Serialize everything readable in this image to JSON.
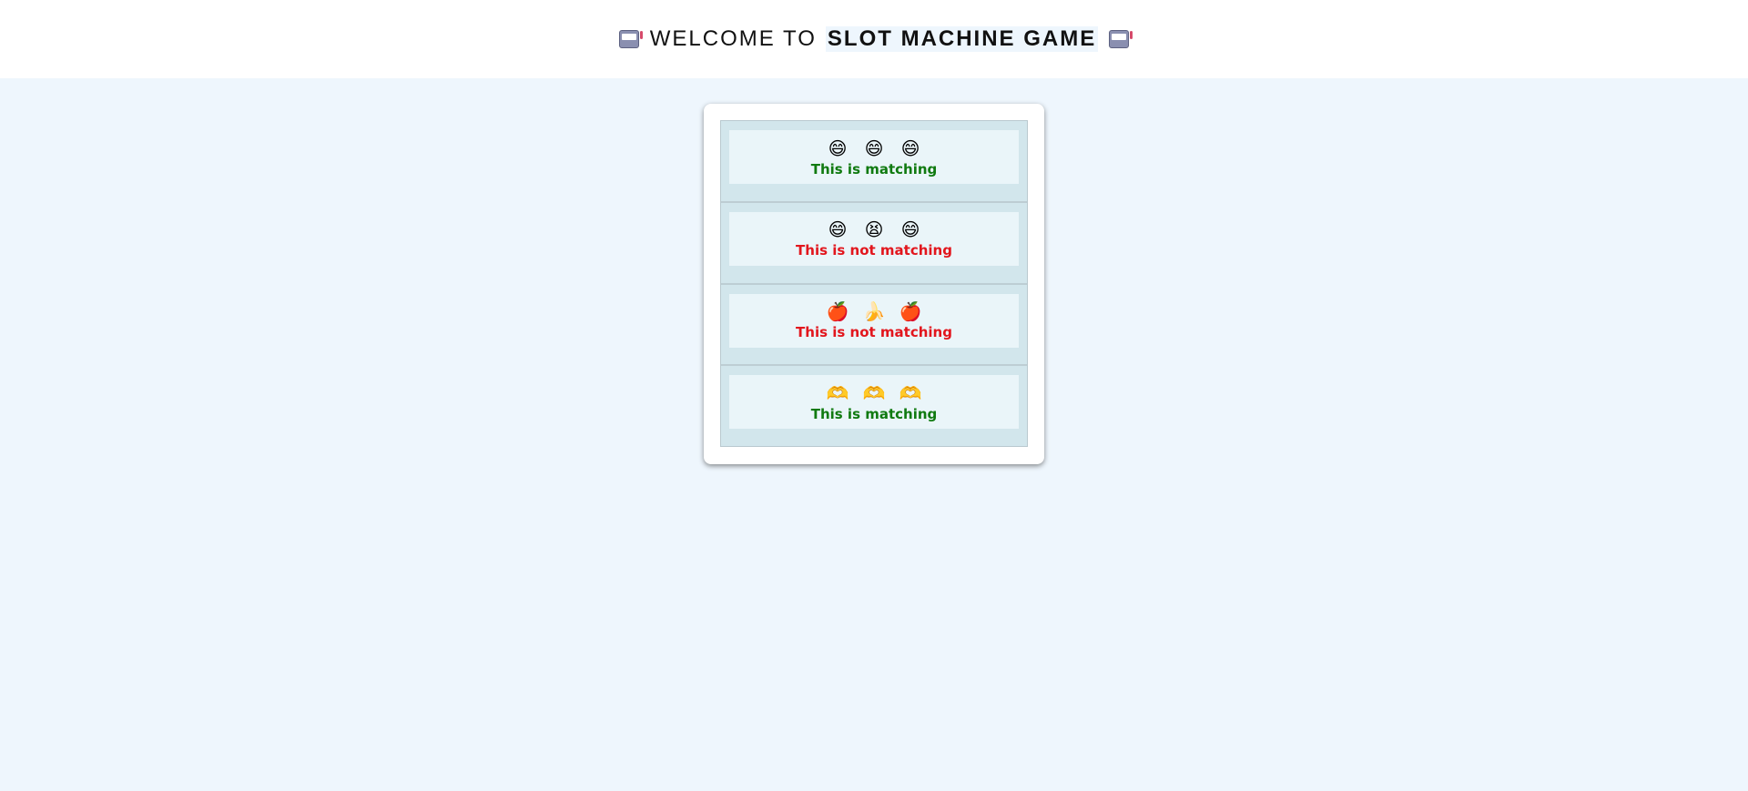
{
  "header": {
    "title_prefix": "WELCOME TO",
    "title_bold": "SLOT MACHINE GAME",
    "left_icon": "slot-machine-icon",
    "right_icon": "slot-machine-icon"
  },
  "rows": [
    {
      "symbols": [
        "😄",
        "😄",
        "😄"
      ],
      "result": "This is matching",
      "status": "match"
    },
    {
      "symbols": [
        "😄",
        "😫",
        "😄"
      ],
      "result": "This is not matching",
      "status": "nomatch"
    },
    {
      "symbols": [
        "🍎",
        "🍌",
        "🍎"
      ],
      "result": "This is not matching",
      "status": "nomatch"
    },
    {
      "symbols": [
        "🫶",
        "🫶",
        "🫶"
      ],
      "result": "This is matching",
      "status": "match"
    }
  ],
  "colors": {
    "page_background": "#eef6fd",
    "match_text": "#107a10",
    "nomatch_text": "#e2161d",
    "row_background": "#d2e6ec",
    "row_inner_background": "#eaf5f9"
  }
}
